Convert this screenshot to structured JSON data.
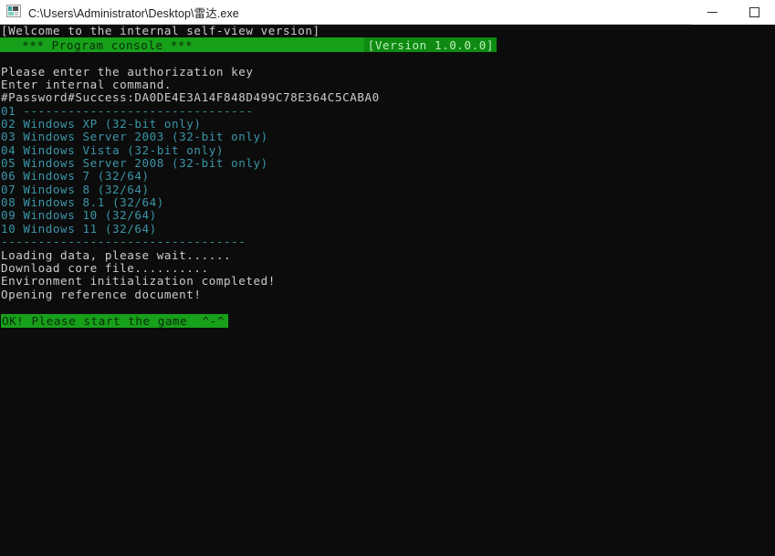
{
  "window": {
    "title": "C:\\Users\\Administrator\\Desktop\\雷达.exe",
    "icon": "console-app-icon",
    "controls": {
      "minimize_label": "−",
      "maximize_label": "□"
    },
    "titlebar_bg": "#ffffff",
    "console_bg": "#0c0c0c"
  },
  "console": {
    "welcome_line": "[Welcome to the internal self-view version]",
    "banner": {
      "title": " *** Program console ***",
      "version": "[Version 1.0.0.0]",
      "bg_color": "#17a01a",
      "version_bg_color": "#0f8a12"
    },
    "messages": [
      "Please enter the authorization key",
      "Enter internal command.",
      "#Password#Success:DA0DE4E3A14F848D499C78E364C5CABA0"
    ],
    "separator_top": "01 -------------------------------",
    "os_list": [
      "02 Windows XP (32-bit only)",
      "03 Windows Server 2003 (32-bit only)",
      "04 Windows Vista (32-bit only)",
      "05 Windows Server 2008 (32-bit only)",
      "06 Windows 7 (32/64)",
      "07 Windows 8 (32/64)",
      "08 Windows 8.1 (32/64)",
      "09 Windows 10 (32/64)",
      "10 Windows 11 (32/64)"
    ],
    "separator_bottom": "---------------------------------",
    "status_messages": [
      "Loading data, please wait......",
      "Download core file..........",
      "Environment initialization completed!",
      "Opening reference document!"
    ],
    "final_line": "OK! Please start the game  ^-^",
    "final_line_bg": "#17a01a",
    "text_color": "#cccccc",
    "list_color": "#3a96a8"
  }
}
